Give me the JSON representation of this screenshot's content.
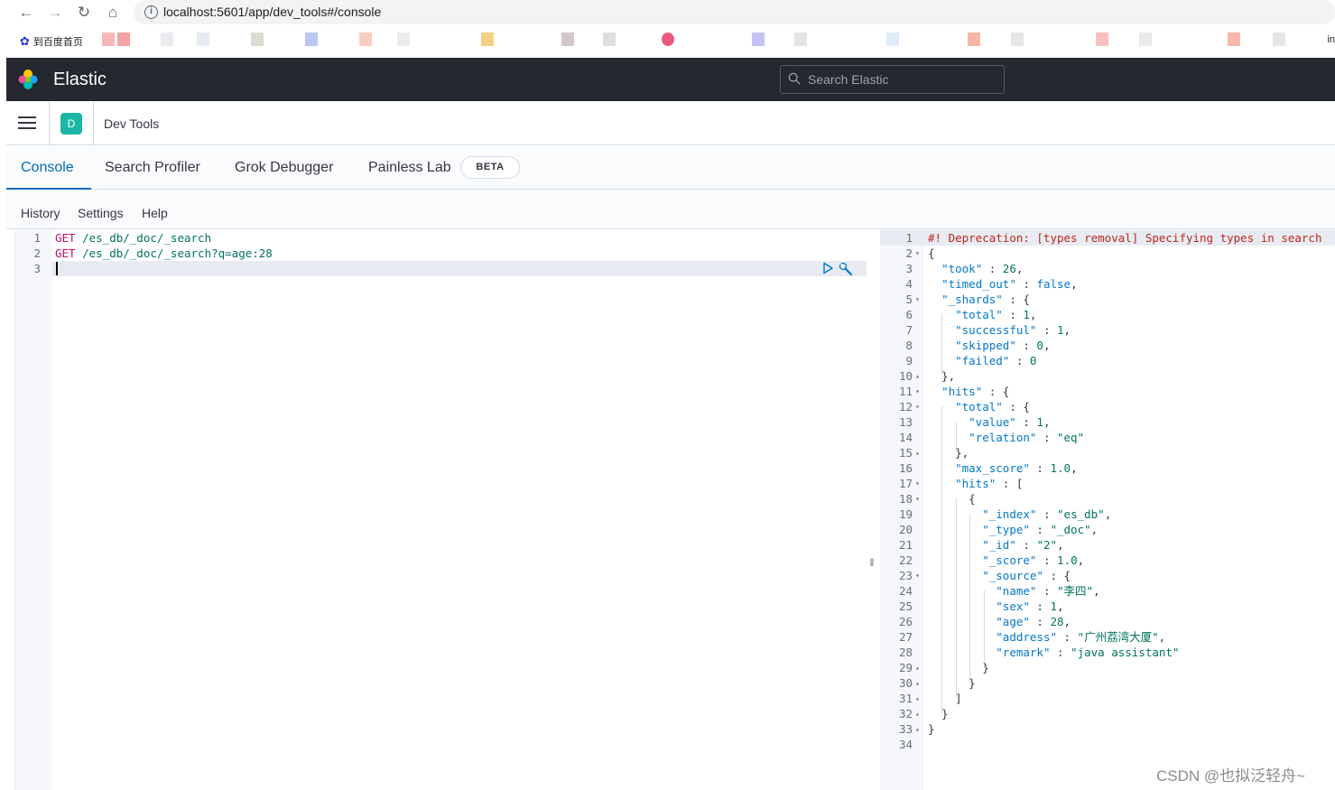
{
  "browser": {
    "url": "localhost:5601/app/dev_tools#/console",
    "bookmark_first": "到百度首页",
    "bookmark_tail": "in"
  },
  "header": {
    "title": "Elastic",
    "search_placeholder": "Search Elastic"
  },
  "breadcrumb": {
    "app_badge": "D",
    "title": "Dev Tools"
  },
  "tabs": [
    {
      "label": "Console",
      "active": true
    },
    {
      "label": "Search Profiler"
    },
    {
      "label": "Grok Debugger"
    },
    {
      "label": "Painless Lab"
    }
  ],
  "beta_label": "BETA",
  "toolbar": {
    "history": "History",
    "settings": "Settings",
    "help": "Help"
  },
  "request": {
    "line_numbers": [
      "1",
      "2",
      "3"
    ],
    "lines": [
      {
        "verb": "GET",
        "path": " /es_db/_doc/_search"
      },
      {
        "verb": "GET",
        "path": " /es_db/_doc/_search?q=age:28"
      },
      {
        "verb": "",
        "path": ""
      }
    ]
  },
  "response": {
    "deprecation": "#! Deprecation: [types removal] Specifying types in search",
    "took": "26",
    "timed_out": "false",
    "shards_total": "1",
    "shards_successful": "1",
    "shards_skipped": "0",
    "shards_failed": "0",
    "hits_total_value": "1",
    "hits_total_relation": "\"eq\"",
    "max_score": "1.0",
    "doc_index": "\"es_db\"",
    "doc_type": "\"_doc\"",
    "doc_id": "\"2\"",
    "doc_score": "1.0",
    "src_name": "\"李四\"",
    "src_sex": "1",
    "src_age": "28",
    "src_address": "\"广州荔湾大厦\"",
    "src_remark": "\"java assistant\""
  },
  "watermark": "CSDN @也拟泛轻舟~"
}
